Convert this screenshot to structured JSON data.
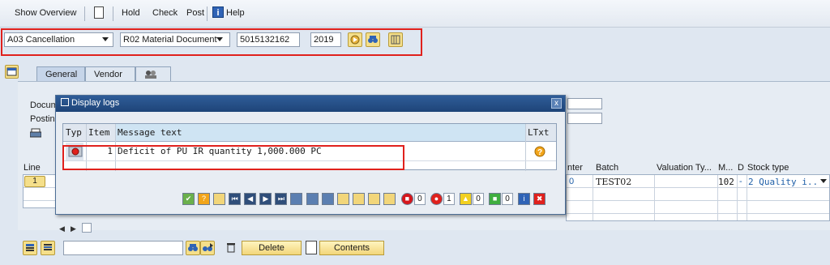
{
  "toolbar": {
    "show_overview": "Show Overview",
    "hold": "Hold",
    "check": "Check",
    "post": "Post",
    "help": "Help",
    "help_icon_glyph": "i"
  },
  "selection": {
    "action": "A03 Cancellation",
    "reference": "R02 Material Document",
    "document_number": "5015132162",
    "year": "2019"
  },
  "tabs": [
    {
      "label": "General",
      "active": true
    },
    {
      "label": "Vendor",
      "active": false
    },
    {
      "label": "",
      "icon": "partner-icon"
    }
  ],
  "header_fields": {
    "document_label": "Docum",
    "posting_label": "Posting"
  },
  "dialog": {
    "title": "Display logs",
    "close_glyph": "x",
    "columns": [
      "Typ",
      "Item",
      "Message text",
      "LTxt"
    ],
    "rows": [
      {
        "type_icon": "error-light-icon",
        "item": "1",
        "message": "Deficit of PU IR quantity 1,000.000 PC",
        "ltxt_icon": "question-icon"
      }
    ],
    "counts": {
      "stop": "0",
      "error": "1",
      "warning": "0",
      "success": "0"
    },
    "info_glyph": "i",
    "cancel_glyph": "✖"
  },
  "items_table": {
    "columns": [
      "Line",
      "nter",
      "Batch",
      "Valuation Ty...",
      "M...",
      "D",
      "Stock type"
    ],
    "rows": [
      {
        "line": "1",
        "center": "0",
        "batch": "TEST02",
        "valuation": "",
        "mvt": "102",
        "d": "-",
        "stock_type": "2 Quality i.."
      }
    ]
  },
  "bottom": {
    "delete": "Delete",
    "contents": "Contents"
  },
  "colors": {
    "sap_blue": "#1e4478",
    "highlight_red": "#e0211d",
    "button_yellow": "#f2d67a"
  }
}
